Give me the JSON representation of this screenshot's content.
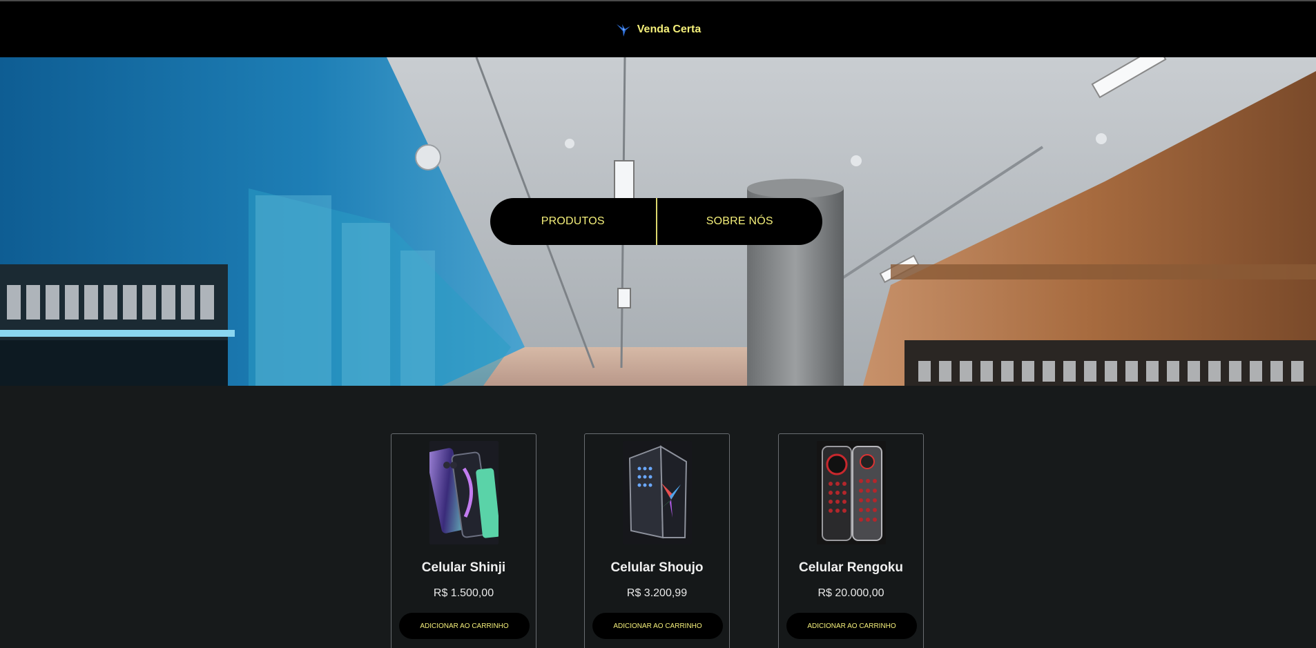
{
  "header": {
    "brand_name": "Venda Certa",
    "brand_icon": "hummingbird-logo-icon",
    "brand_color": "#f4ef7a"
  },
  "hero": {
    "background": "store-interior-photo",
    "nav": {
      "items": [
        {
          "label": "PRODUTOS"
        },
        {
          "label": "SOBRE NÓS"
        }
      ]
    }
  },
  "products": [
    {
      "name": "Celular Shinji",
      "price": "R$ 1.500,00",
      "button_label": "ADICIONAR AO CARRINHO",
      "image": "phone-image-shinji"
    },
    {
      "name": "Celular Shoujo",
      "price": "R$ 3.200,99",
      "button_label": "ADICIONAR AO CARRINHO",
      "image": "phone-image-shoujo"
    },
    {
      "name": "Celular Rengoku",
      "price": "R$ 20.000,00",
      "button_label": "ADICIONAR AO CARRINHO",
      "image": "phone-image-rengoku"
    }
  ],
  "colors": {
    "accent": "#f4ef7a",
    "header_bg": "#000000",
    "page_bg": "#171a1b"
  }
}
